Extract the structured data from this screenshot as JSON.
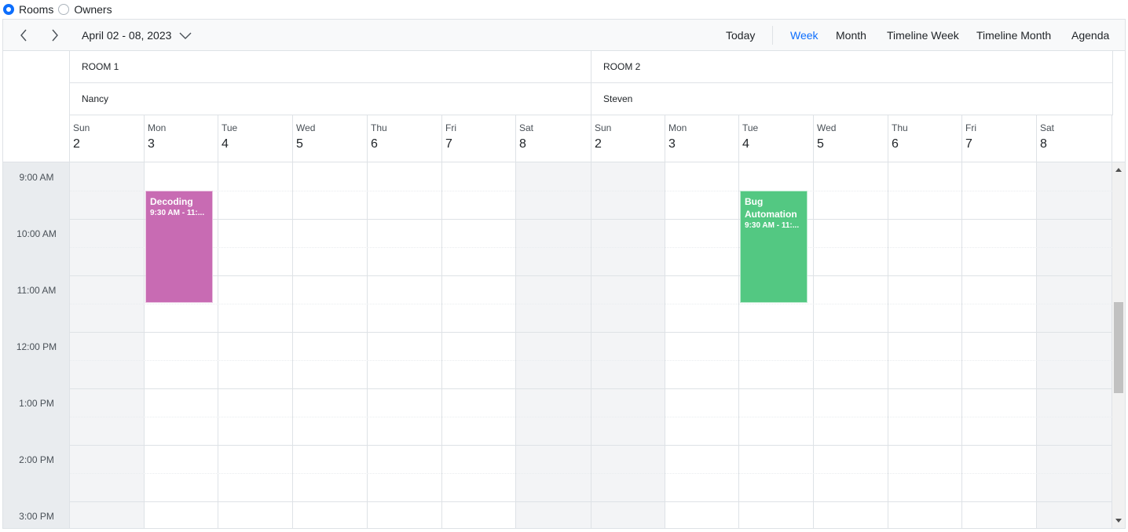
{
  "group_by": {
    "options": [
      {
        "label": "Rooms",
        "checked": true
      },
      {
        "label": "Owners",
        "checked": false
      }
    ]
  },
  "toolbar": {
    "date_range": "April 02 - 08, 2023",
    "today": "Today",
    "views": [
      "Week",
      "Month",
      "Timeline Week",
      "Timeline Month",
      "Agenda"
    ],
    "active_view": "Week"
  },
  "resources": [
    {
      "room": "ROOM 1",
      "owner": "Nancy"
    },
    {
      "room": "ROOM 2",
      "owner": "Steven"
    }
  ],
  "days": [
    {
      "name": "Sun",
      "num": "2"
    },
    {
      "name": "Mon",
      "num": "3"
    },
    {
      "name": "Tue",
      "num": "4"
    },
    {
      "name": "Wed",
      "num": "5"
    },
    {
      "name": "Thu",
      "num": "6"
    },
    {
      "name": "Fri",
      "num": "7"
    },
    {
      "name": "Sat",
      "num": "8"
    }
  ],
  "times": [
    "9:00 AM",
    "10:00 AM",
    "11:00 AM",
    "12:00 PM",
    "1:00 PM",
    "2:00 PM",
    "3:00 PM"
  ],
  "events": [
    {
      "title": "Decoding",
      "time": "9:30 AM - 11:...",
      "color": "#c86bb3"
    },
    {
      "title": "Bug Automation",
      "time": "9:30 AM - 11:...",
      "color": "#53c882"
    }
  ],
  "colors": {
    "accent": "#0d6efd",
    "border": "#dee2e6"
  }
}
